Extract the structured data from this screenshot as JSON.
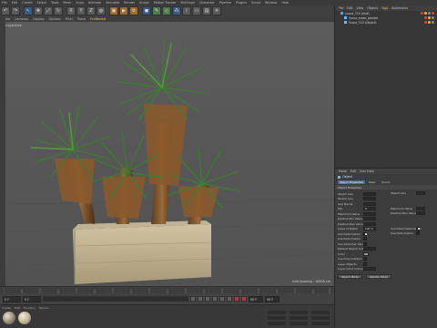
{
  "menubar": [
    "File",
    "Edit",
    "Create",
    "Select",
    "Tools",
    "Mesh",
    "Snap",
    "Animate",
    "Simulate",
    "Render",
    "Sculpt",
    "Motion Tracker",
    "MoGraph",
    "Character",
    "Pipeline",
    "Plugins",
    "Script",
    "Window",
    "Help"
  ],
  "toolbar": {
    "axis_x": "X",
    "axis_y": "Y",
    "axis_z": "Z"
  },
  "viewport": {
    "menu": [
      "View",
      "Cameras",
      "Display",
      "Options",
      "Filter",
      "Panel",
      "ProRender"
    ],
    "active_menu": "ProRender",
    "label": "Perspective",
    "hud": "Grid Spacing : 10000 cm"
  },
  "timeline": {
    "start_field": "0 F",
    "current_field": "0 F",
    "end_field": "90 F",
    "end_field2": "90 F"
  },
  "material_manager": {
    "menu": [
      "Create",
      "Edit",
      "Function",
      "Texture"
    ],
    "balls": [
      "#8a8170",
      "#b8aa8c"
    ]
  },
  "object_manager": {
    "menu": [
      "File",
      "Edit",
      "View",
      "Objects",
      "Tags",
      "Bookmarks"
    ],
    "active_menu": "Tags",
    "objects": [
      {
        "name": "yucca_T10 (Null)",
        "indent": 0
      },
      {
        "name": "Yucca_mesh_planter",
        "indent": 1
      },
      {
        "name": "Yucca_T10 (Object)",
        "indent": 1
      }
    ],
    "tag_colors": [
      "#d24a3a",
      "#e0b44a",
      "#8a8a8a"
    ]
  },
  "attribute_manager": {
    "menu": [
      "Mode",
      "Edit",
      "User Data"
    ],
    "title": "Object",
    "tabs": [
      "Object Properties",
      "Basic",
      "Coord."
    ],
    "section": "Object Properties",
    "left_rows": [
      {
        "label": "Object Axis",
        "value": "",
        "type": "field"
      },
      {
        "label": "Parent Axis",
        "value": "",
        "type": "field"
      },
      {
        "label": "Axis Bands",
        "value": "",
        "type": "field"
      },
      {
        "label": "Min",
        "value": "0",
        "type": "field"
      },
      {
        "label": "Maximum Value",
        "value": "",
        "type": "field"
      },
      {
        "label": "Positive Min Value",
        "value": "",
        "type": "field"
      },
      {
        "label": "Positive Max Value",
        "value": "",
        "type": "field"
      },
      {
        "label": "Level of Detail",
        "value": "100 %",
        "type": "field"
      },
      {
        "label": "Use Deformation",
        "value": "",
        "type": "check"
      },
      {
        "label": "Use Deformation",
        "value": "",
        "type": "check"
      },
      {
        "label": "Use Deformer Values",
        "value": "",
        "type": "check"
      },
      {
        "label": "Default Object Color",
        "value": "",
        "type": "field"
      },
      {
        "label": "Color",
        "value": "",
        "type": "field"
      },
      {
        "label": "Use Only Collision",
        "value": "",
        "type": "check"
      },
      {
        "label": "Layer Objects",
        "value": "",
        "type": "check"
      },
      {
        "label": "Layer Color Colors",
        "value": "",
        "type": "field"
      }
    ],
    "right_rows": [
      {
        "label": "Object Axis",
        "value": ""
      },
      {
        "label": "Maximum Value",
        "value": ""
      },
      {
        "label": "Positive Max Value",
        "value": ""
      },
      {
        "label": "Unlimited Deformation",
        "value": ""
      },
      {
        "label": "Use Deformation",
        "value": ""
      }
    ],
    "buttons": [
      "Object Mode",
      "Render Mode"
    ]
  }
}
